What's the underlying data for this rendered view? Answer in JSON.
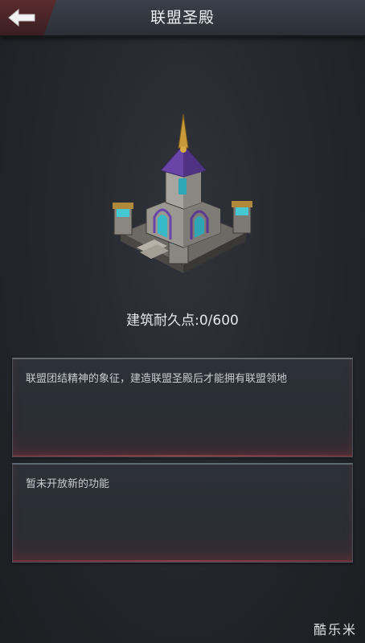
{
  "header": {
    "title": "联盟圣殿",
    "back_icon": "back-arrow-icon"
  },
  "building": {
    "icon": "alliance-temple-icon",
    "durability_label": "建筑耐久点:0/600"
  },
  "panels": [
    {
      "text": "联盟团结精神的象征，建造联盟圣殿后才能拥有联盟领地"
    },
    {
      "text": "暂未开放新的功能"
    }
  ],
  "watermark": {
    "text": "酷乐米"
  },
  "colors": {
    "accent_red": "#5b2b2f",
    "panel_bg": "#2c3038",
    "text": "#d6d9de"
  }
}
